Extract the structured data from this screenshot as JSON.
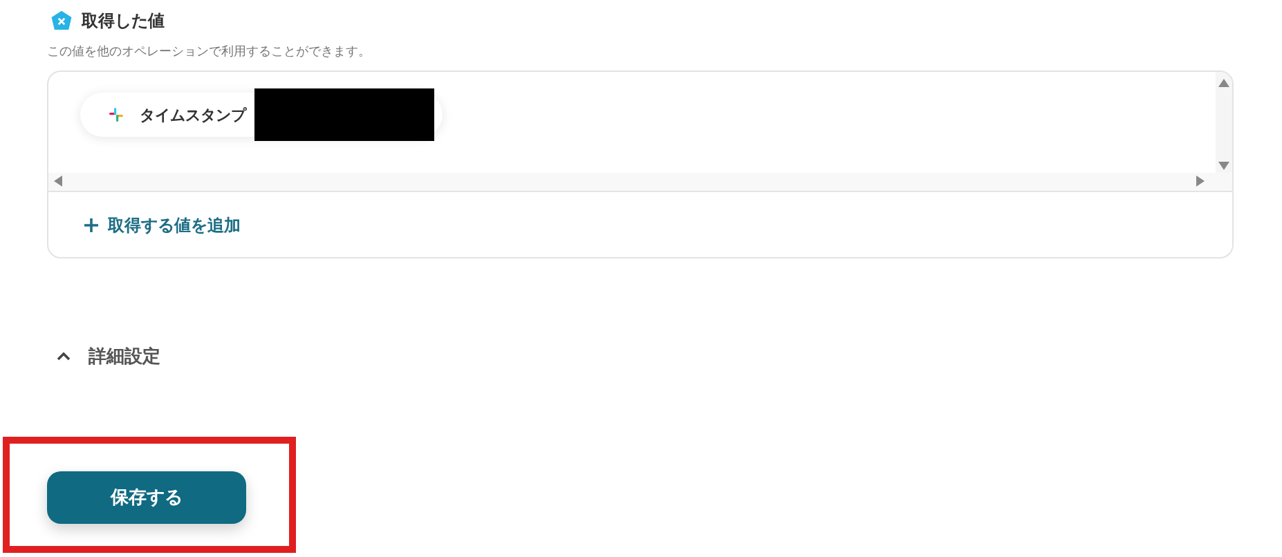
{
  "section": {
    "title": "取得した値",
    "description": "この値を他のオペレーションで利用することができます。"
  },
  "values": [
    {
      "label": "タイムスタンプ",
      "redacted": true
    }
  ],
  "add_value": {
    "label": "取得する値を追加"
  },
  "advanced": {
    "label": "詳細設定",
    "expanded": true
  },
  "save_button": {
    "label": "保存する",
    "highlighted": true
  }
}
